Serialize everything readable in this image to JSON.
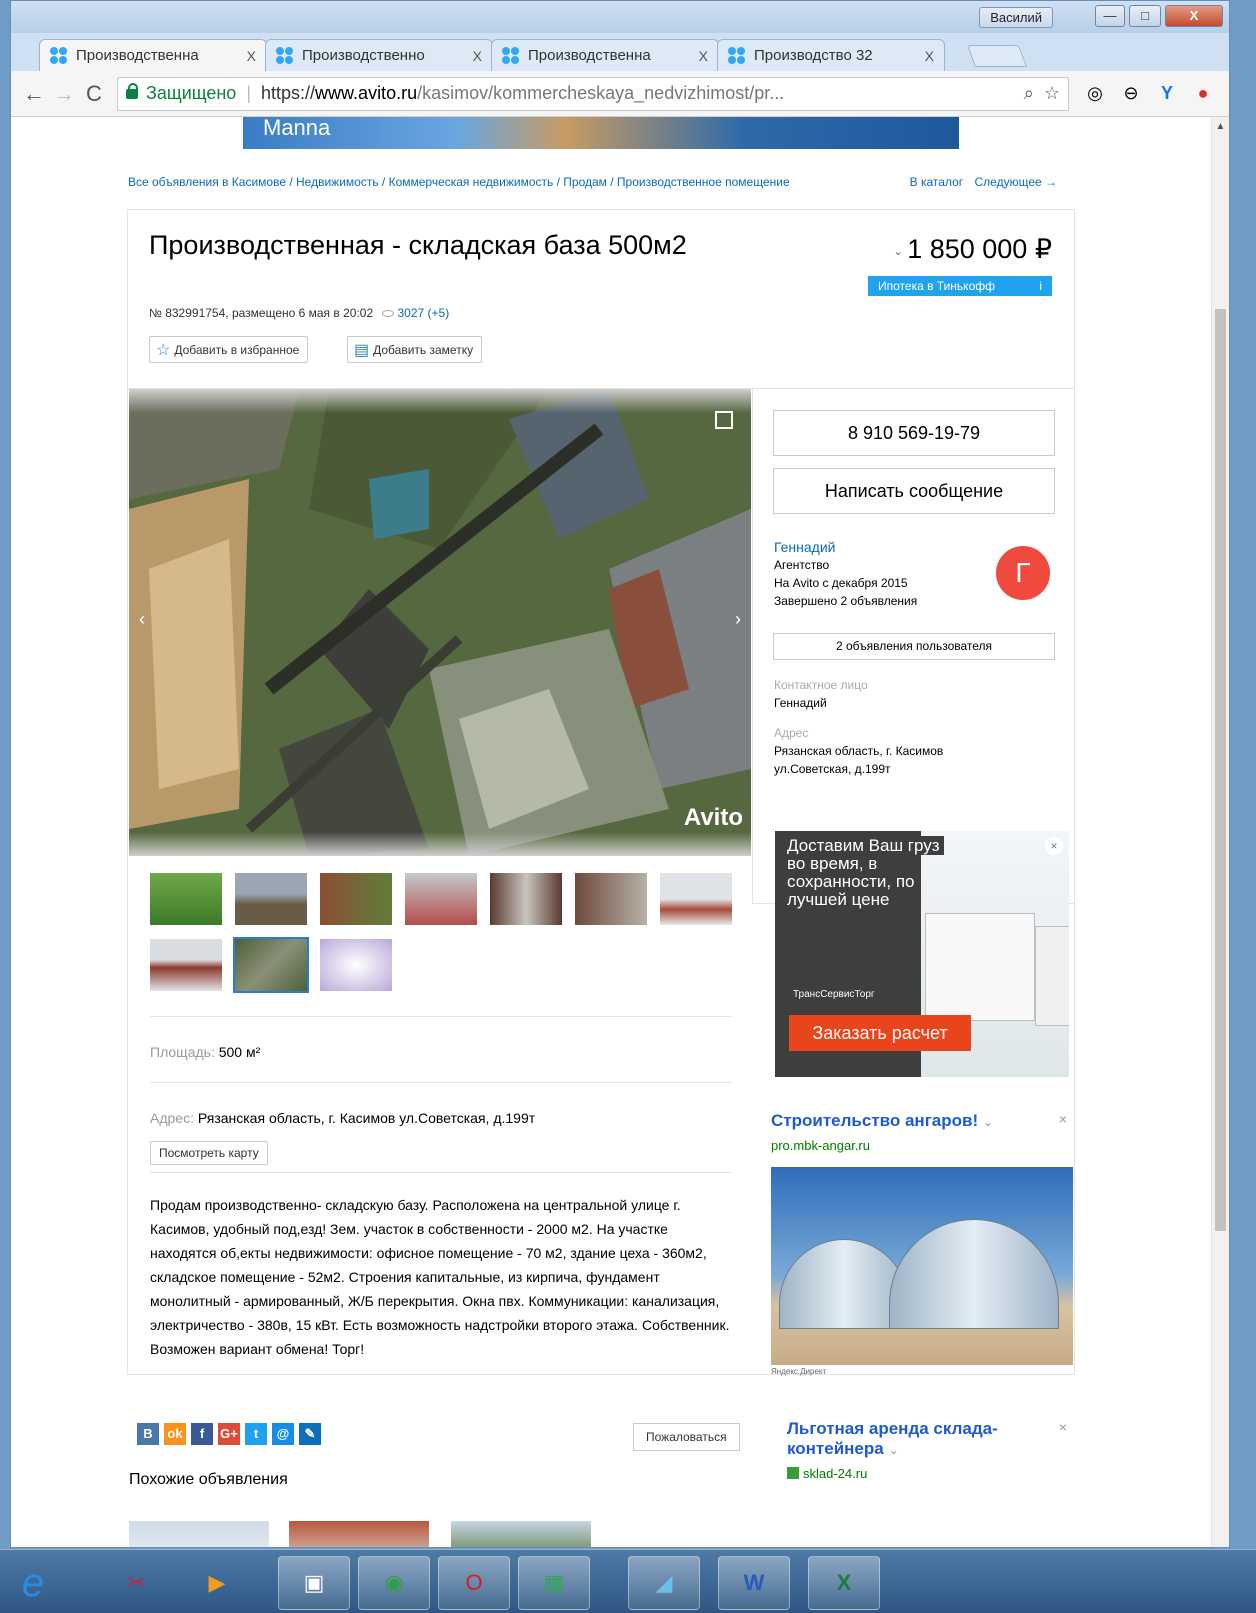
{
  "window": {
    "user": "Василий",
    "minimize": "—",
    "maximize": "□",
    "close": "X"
  },
  "tabs": [
    {
      "label": "Производственна",
      "close": "X"
    },
    {
      "label": "Производственно",
      "close": "X"
    },
    {
      "label": "Производственна",
      "close": "X"
    },
    {
      "label": "Производство 32",
      "close": "X"
    }
  ],
  "toolbar": {
    "back": "←",
    "forward": "→",
    "reload": "C",
    "secure_label": "Защищено",
    "url_scheme": "https://",
    "url_host": "www.avito.ru",
    "url_path": "/kasimov/kommercheskaya_nedvizhimost/pr...",
    "zoom_icon": "⌕",
    "star_icon": "☆"
  },
  "banner": {
    "text": "Manna"
  },
  "breadcrumbs": "Все объявления в Касимове / Недвижимость / Коммерческая недвижимость / Продам / Производственное помещение",
  "catalog_links": {
    "catalog": "В каталог",
    "next": "Следующее →"
  },
  "listing": {
    "title": "Производственная - складская база 500м2",
    "meta": "№ 832991754, размещено 6 мая в 20:02",
    "views": "3027 (+5)",
    "price_chev": "⌄",
    "price": "1 850 000 ₽",
    "mortgage": "Ипотека в Тинькофф",
    "mortgage_info": "i",
    "add_favorite": "Добавить в избранное",
    "add_note": "Добавить заметку",
    "photo_brand": "Avito",
    "prev": "‹",
    "next": "›"
  },
  "params": {
    "area_key": "Площадь:",
    "area_val": "500 м²",
    "address_key": "Адрес:",
    "address_val": "Рязанская область, г. Касимов ул.Советская, д.199т",
    "map_button": "Посмотреть карту"
  },
  "description": "Продам производственно- складскую базу. Расположена на центральной улице г. Касимов, удобный под,езд! Зем. участок в собственности - 2000 м2. На участке находятся об,екты недвижимости: офисное помещение - 70 м2, здание цеха - 360м2, складское помещение - 52м2. Строения капитальные, из кирпича, фундамент монолитный - армированный, Ж/Б перекрытия. Окна пвх. Коммуникации: канализация, электричество - 380в, 15 кВт. Есть возможность надстройки второго этажа. Собственник. Возможен вариант обмена! Торг!",
  "seller": {
    "phone": "8 910 569-19-79",
    "message": "Написать сообщение",
    "name": "Геннадий",
    "type": "Агентство",
    "since": "На Avito с декабря 2015",
    "completed": "Завершено 2 объявления",
    "avatar_letter": "Г",
    "user_ads": "2 объявления пользователя",
    "contact_label": "Контактное лицо",
    "contact_name": "Геннадий",
    "address_label": "Адрес",
    "address_line1": "Рязанская область, г. Касимов",
    "address_line2": "ул.Советская, д.199т"
  },
  "ads": {
    "ad1_headline_1": "Доставим Ваш груз",
    "ad1_headline_2": "во время, в",
    "ad1_headline_3": "сохранности, по",
    "ad1_headline_4": "лучшей цене",
    "ad1_logo": "ТрансСервисТорг",
    "ad1_cta": "Заказать расчет",
    "ad1_close": "×",
    "ad2_title": "Строительство ангаров!",
    "ad2_domain": "pro.mbk-angar.ru",
    "ad2_close": "×",
    "yandex": "Яндекс.Директ",
    "ad3_title": "Льготная аренда склада-контейнера",
    "ad3_domain": "sklad-24.ru",
    "ad3_close": "×",
    "chev": "⌄"
  },
  "share": {
    "vk": "B",
    "ok": "ok",
    "fb": "f",
    "gp": "G+",
    "tw": "t",
    "mail": "@",
    "lj": "✎"
  },
  "complain": "Пожаловаться",
  "similar_title": "Похожие объявления",
  "colors": {
    "accent": "#0a6ab8",
    "mortgage": "#1fa3ee",
    "avatar": "#f0493e",
    "ad_cta": "#e8451d"
  }
}
